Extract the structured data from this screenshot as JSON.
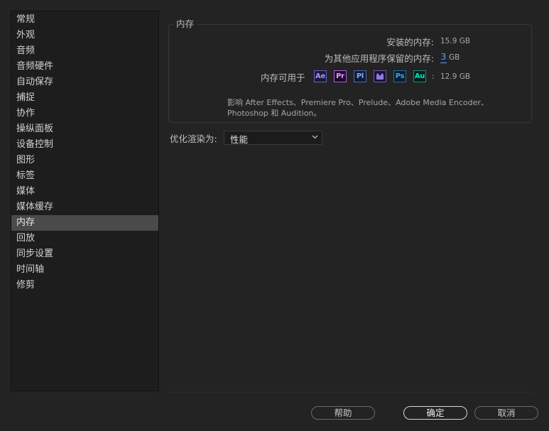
{
  "sidebar": {
    "items": [
      {
        "label": "常规"
      },
      {
        "label": "外观"
      },
      {
        "label": "音频"
      },
      {
        "label": "音频硬件"
      },
      {
        "label": "自动保存"
      },
      {
        "label": "捕捉"
      },
      {
        "label": "协作"
      },
      {
        "label": "操纵面板"
      },
      {
        "label": "设备控制"
      },
      {
        "label": "图形"
      },
      {
        "label": "标签"
      },
      {
        "label": "媒体"
      },
      {
        "label": "媒体缓存"
      },
      {
        "label": "内存",
        "selected": true
      },
      {
        "label": "回放"
      },
      {
        "label": "同步设置"
      },
      {
        "label": "时间轴"
      },
      {
        "label": "修剪"
      }
    ]
  },
  "memory": {
    "title": "内存",
    "installed_label": "安装的内存:",
    "installed_value": "15.9 GB",
    "reserved_label": "为其他应用程序保留的内存:",
    "reserved_value": "3",
    "reserved_unit": "GB",
    "available_label": "内存可用于",
    "available_sep": ":",
    "available_value": "12.9 GB",
    "apps": [
      {
        "name": "Ae",
        "icon": "after-effects-icon",
        "color": "#9999ff",
        "bg": "#1d1a33",
        "border": "#6b5fc4"
      },
      {
        "name": "Pr",
        "icon": "premiere-pro-icon",
        "color": "#e4a0ff",
        "bg": "#1f0a2a",
        "border": "#b05cd6"
      },
      {
        "name": "Pl",
        "icon": "prelude-icon",
        "color": "#7fb0ff",
        "bg": "#121a33",
        "border": "#4a6ab8"
      },
      {
        "name": "Me",
        "icon": "media-encoder-icon",
        "color": "#a78bff",
        "bg": "#1a1433",
        "border": "#6c56bd"
      },
      {
        "name": "Ps",
        "icon": "photoshop-icon",
        "color": "#31a8ff",
        "bg": "#0b1c2d",
        "border": "#2d6a99"
      },
      {
        "name": "Au",
        "icon": "audition-icon",
        "color": "#00e4bb",
        "bg": "#07211c",
        "border": "#1f8c75"
      }
    ],
    "note": "影响 After Effects、Premiere Pro、Prelude、Adobe Media Encoder、Photoshop 和 Audition。"
  },
  "render": {
    "label": "优化渲染为:",
    "selected": "性能"
  },
  "buttons": {
    "help": "帮助",
    "ok": "确定",
    "cancel": "取消"
  }
}
